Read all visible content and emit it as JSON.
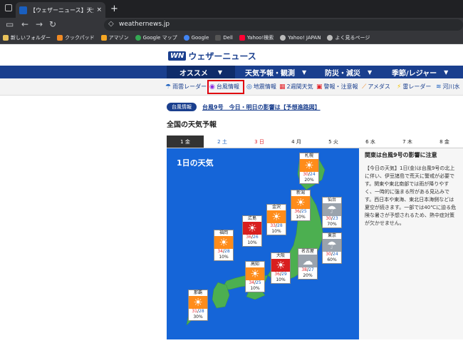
{
  "browser": {
    "tab_title": "【ウェザーニュース】天気・台風・地",
    "tab_close": "×",
    "new_tab": "+",
    "url": "weathernews.jp",
    "bookmarks": [
      "新しいフォルダー",
      "クックパッド",
      "アマゾン",
      "Google マップ",
      "Google",
      "Dell",
      "Yahoo!検索",
      "Yahoo! JAPAN",
      "よく見るページ"
    ]
  },
  "site": {
    "logo_mark": "WN",
    "logo_text": "ウェザーニュース",
    "main_nav": [
      "オススメ",
      "天気予報・観測",
      "防災・減災",
      "季節/レジャー"
    ],
    "sub_nav": [
      "雨雲レーダー",
      "台風情報",
      "地震情報",
      "2週間天気",
      "警報・注意報",
      "アメダス",
      "雷レーダー",
      "河川水"
    ]
  },
  "alert": {
    "badge": "台風情報",
    "link": "台風9号　今日・明日の影響は【予想進路図】"
  },
  "section_title": "全国の天気予報",
  "day_tabs": [
    "1 金",
    "2 土",
    "3 日",
    "4 月",
    "5 火",
    "6 水",
    "7 木",
    "8 金"
  ],
  "map": {
    "title": "1日の天気",
    "cities": [
      {
        "name": "札幌",
        "hi": "30",
        "lo": "24",
        "pop": "20%",
        "icon": "sun-cloud"
      },
      {
        "name": "新潟",
        "hi": "36",
        "lo": "25",
        "pop": "10%",
        "icon": "sun"
      },
      {
        "name": "仙台",
        "hi": "30",
        "lo": "23",
        "pop": "70%",
        "icon": "rain"
      },
      {
        "name": "金沢",
        "hi": "33",
        "lo": "28",
        "pop": "10%",
        "icon": "sun"
      },
      {
        "name": "東京",
        "hi": "30",
        "lo": "24",
        "pop": "60%",
        "icon": "rain"
      },
      {
        "name": "広島",
        "hi": "36",
        "lo": "26",
        "pop": "10%",
        "icon": "hot"
      },
      {
        "name": "福岡",
        "hi": "34",
        "lo": "28",
        "pop": "10%",
        "icon": "sun"
      },
      {
        "name": "名古屋",
        "hi": "38",
        "lo": "27",
        "pop": "20%",
        "icon": "cloud-hot"
      },
      {
        "name": "大阪",
        "hi": "36",
        "lo": "29",
        "pop": "10%",
        "icon": "hot"
      },
      {
        "name": "高知",
        "hi": "34",
        "lo": "25",
        "pop": "10%",
        "icon": "sun"
      },
      {
        "name": "那覇",
        "hi": "31",
        "lo": "28",
        "pop": "30%",
        "icon": "sun"
      }
    ]
  },
  "forecast": {
    "title": "関東は台風9号の影響に注意",
    "body": "【今日の天気】1日(金)は台風9号の北上に伴い、伊豆諸島で荒天に警戒が必要です。関東や東北南部では雨が降りやすく、一時的に強まる所がある見込みです。西日本や東海、東北日本海側などは夏空が続きます。一部では40℃に迫る危険な暑さが予想されるため、熱中症対策が欠かせません。"
  }
}
